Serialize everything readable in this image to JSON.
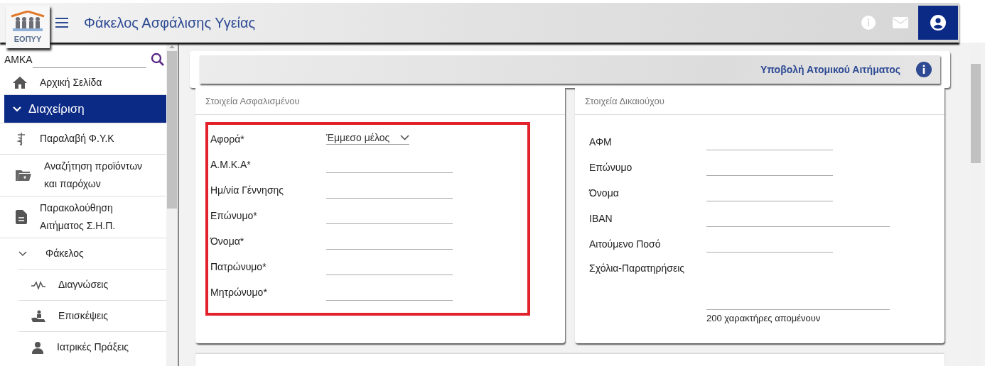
{
  "header": {
    "title": "Φάκελος Ασφάλισης Υγείας",
    "logo_text": "ΕΟΠΥΥ"
  },
  "sidebar": {
    "search": {
      "label": "ΑΜΚΑ"
    },
    "items": [
      {
        "kind": "link",
        "label": "Αρχική Σελίδα",
        "selected": false
      },
      {
        "kind": "group",
        "label": "Διαχείριση",
        "selected": true,
        "expanded": true,
        "children": [
          {
            "kind": "link",
            "label": "Παραλαβή Φ.Υ.Κ",
            "selected": false
          },
          {
            "kind": "link",
            "label": "Αναζήτηση προϊόντων και παρόχων",
            "selected": false
          },
          {
            "kind": "link",
            "label": "Παρακολούθηση Αιτήματος Σ.Η.Π.",
            "selected": false
          },
          {
            "kind": "group",
            "label": "Φάκελος",
            "selected": false,
            "expanded": true,
            "children": [
              {
                "kind": "link",
                "label": "Διαγνώσεις",
                "selected": false
              },
              {
                "kind": "link",
                "label": "Επισκέψεις",
                "selected": false
              },
              {
                "kind": "link",
                "label": "Ιατρικές Πράξεις",
                "selected": false
              }
            ]
          }
        ]
      }
    ]
  },
  "action_bar": {
    "label": "Υποβολή Ατομικού Αιτήματος"
  },
  "insured_card": {
    "title": "Στοιχεία Ασφαλισμένου",
    "fields": [
      {
        "kind": "select",
        "label": "Αφορά*",
        "value": "Έμμεσο μέλος"
      },
      {
        "kind": "text",
        "label": "Α.Μ.Κ.Α*"
      },
      {
        "kind": "text",
        "label": "Ημ/νία Γέννησης"
      },
      {
        "kind": "text",
        "label": "Επώνυμο*"
      },
      {
        "kind": "text",
        "label": "Όνομα*"
      },
      {
        "kind": "text",
        "label": "Πατρώνυμο*"
      },
      {
        "kind": "text",
        "label": "Μητρώνυμο*"
      }
    ]
  },
  "beneficiary_card": {
    "title": "Στοιχεία Δικαιούχου",
    "fields": [
      {
        "kind": "text",
        "label": "ΑΦΜ"
      },
      {
        "kind": "text",
        "label": "Επώνυμο"
      },
      {
        "kind": "text",
        "label": "Όνομα"
      },
      {
        "kind": "wide",
        "label": "IBAN"
      },
      {
        "kind": "text",
        "label": "Αιτούμενο Ποσό"
      },
      {
        "kind": "textarea",
        "label": "Σχόλια-Παρατηρήσεις",
        "helper": "200 χαρακτήρες απομένουν"
      }
    ]
  }
}
